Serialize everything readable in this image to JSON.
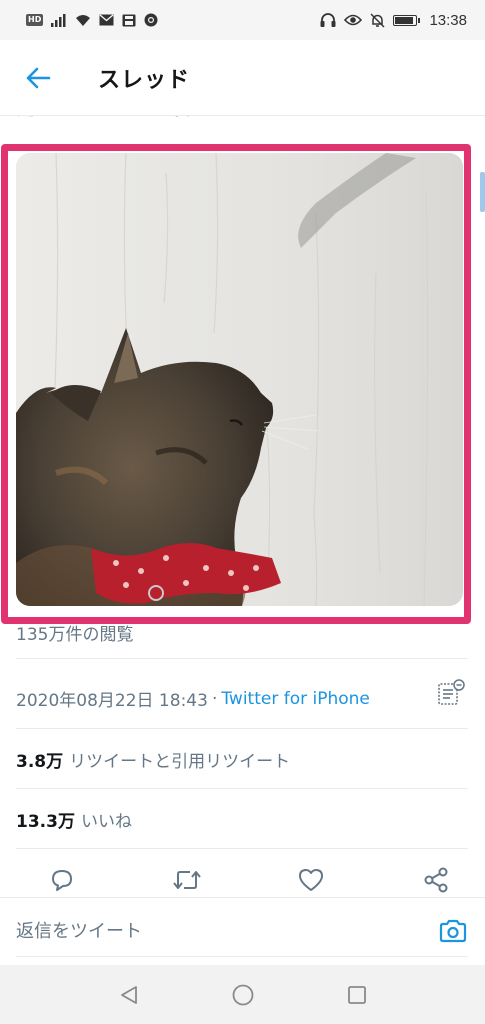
{
  "status_bar": {
    "hd_badge": "HD",
    "time": "13:38",
    "icons_left": [
      "hd-icon",
      "signal-icon",
      "wifi-icon",
      "mail-icon",
      "storage-icon",
      "chrome-icon"
    ],
    "icons_right": [
      "headphones-icon",
      "eye-icon",
      "mute-icon",
      "battery-icon"
    ],
    "battery_level": 0.9
  },
  "header": {
    "title": "スレッド",
    "back_icon": "arrow-left-icon"
  },
  "tweet": {
    "text_partial": "方ありなん！猫なん！！",
    "views": "135万件の閲覧",
    "date": "2020年08月22日 18:43",
    "separator": "·",
    "source": "Twitter for iPhone",
    "retweets_count": "3.8万",
    "retweets_label": "リツイートと引用リツイート",
    "likes_count": "13.3万",
    "likes_label": "いいね"
  },
  "actions": [
    "reply-icon",
    "retweet-icon",
    "like-icon",
    "share-icon"
  ],
  "reply": {
    "placeholder": "返信をツイート"
  },
  "nav": [
    "back-triangle-icon",
    "home-circle-icon",
    "recents-square-icon"
  ],
  "colors": {
    "accent": "#1b95e0",
    "highlight": "#e0336f",
    "secondary_text": "#657786",
    "primary_text": "#14171a"
  }
}
